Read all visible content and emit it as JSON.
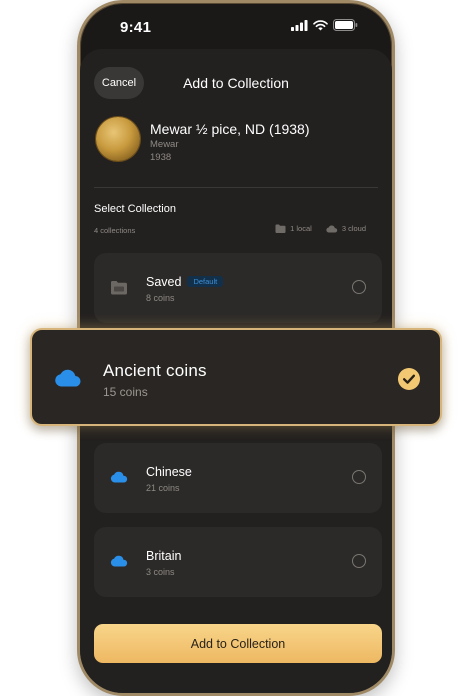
{
  "status_bar": {
    "time": "9:41"
  },
  "sheet": {
    "cancel_label": "Cancel",
    "title": "Add to Collection"
  },
  "coin": {
    "title": "Mewar ½ pice, ND (1938)",
    "region": "Mewar",
    "year": "1938"
  },
  "collections_header": {
    "label": "Select Collection",
    "count": "4 collections",
    "local": "1 local",
    "cloud": "3 cloud"
  },
  "collections": [
    {
      "name": "Saved",
      "badge": "Default",
      "count": "8 coins",
      "storage": "local",
      "selected": false
    },
    {
      "name": "Ancient coins",
      "count": "15 coins",
      "storage": "cloud",
      "selected": true
    },
    {
      "name": "Chinese",
      "count": "21 coins",
      "storage": "cloud",
      "selected": false
    },
    {
      "name": "Britain",
      "count": "3 coins",
      "storage": "cloud",
      "selected": false
    }
  ],
  "actions": {
    "add_label": "Add to Collection"
  },
  "colors": {
    "accent": "#f3c872",
    "cloud_blue": "#2a8fe8",
    "background": "#232120"
  }
}
